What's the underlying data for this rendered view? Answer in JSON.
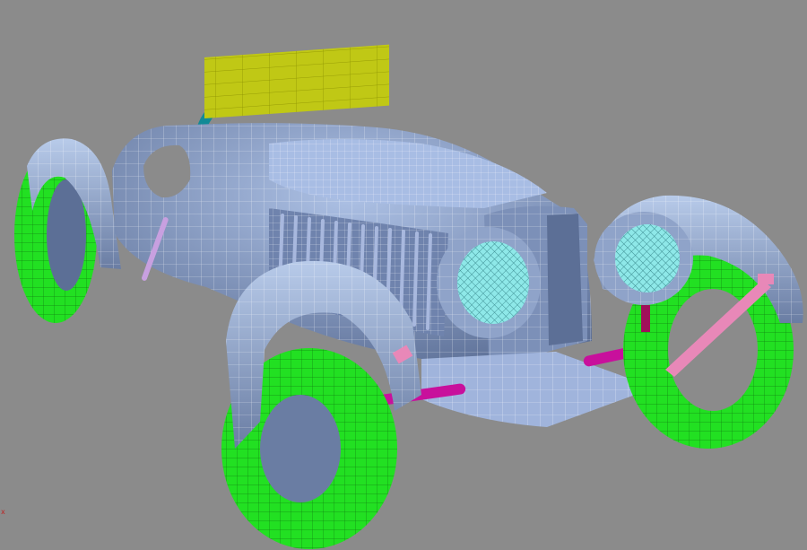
{
  "viewport": {
    "background": "#8b8b8b",
    "axis_label": "x"
  },
  "colors": {
    "body": "#98aed6",
    "body_dark": "#5c6f96",
    "wire": "#ffffff",
    "tire": "#22e022",
    "tire_dark": "#129a12",
    "windshield": "#c0c815",
    "light_glass": "#8ee8e8",
    "axle": "#c8109c",
    "pink_part": "#e888b8",
    "teal_rim": "#128a96",
    "grille_stripe": "#a8b8de"
  },
  "objects": [
    {
      "name": "car-body-mesh",
      "kind": "body"
    },
    {
      "name": "windshield-mesh",
      "kind": "windshield"
    },
    {
      "name": "front-left-wheel-mesh",
      "kind": "tire"
    },
    {
      "name": "front-right-wheel-mesh",
      "kind": "tire"
    },
    {
      "name": "rear-left-wheel-mesh",
      "kind": "tire"
    },
    {
      "name": "left-headlight-mesh",
      "kind": "headlight"
    },
    {
      "name": "right-headlight-mesh",
      "kind": "headlight"
    },
    {
      "name": "front-axle-mesh",
      "kind": "axle"
    }
  ]
}
